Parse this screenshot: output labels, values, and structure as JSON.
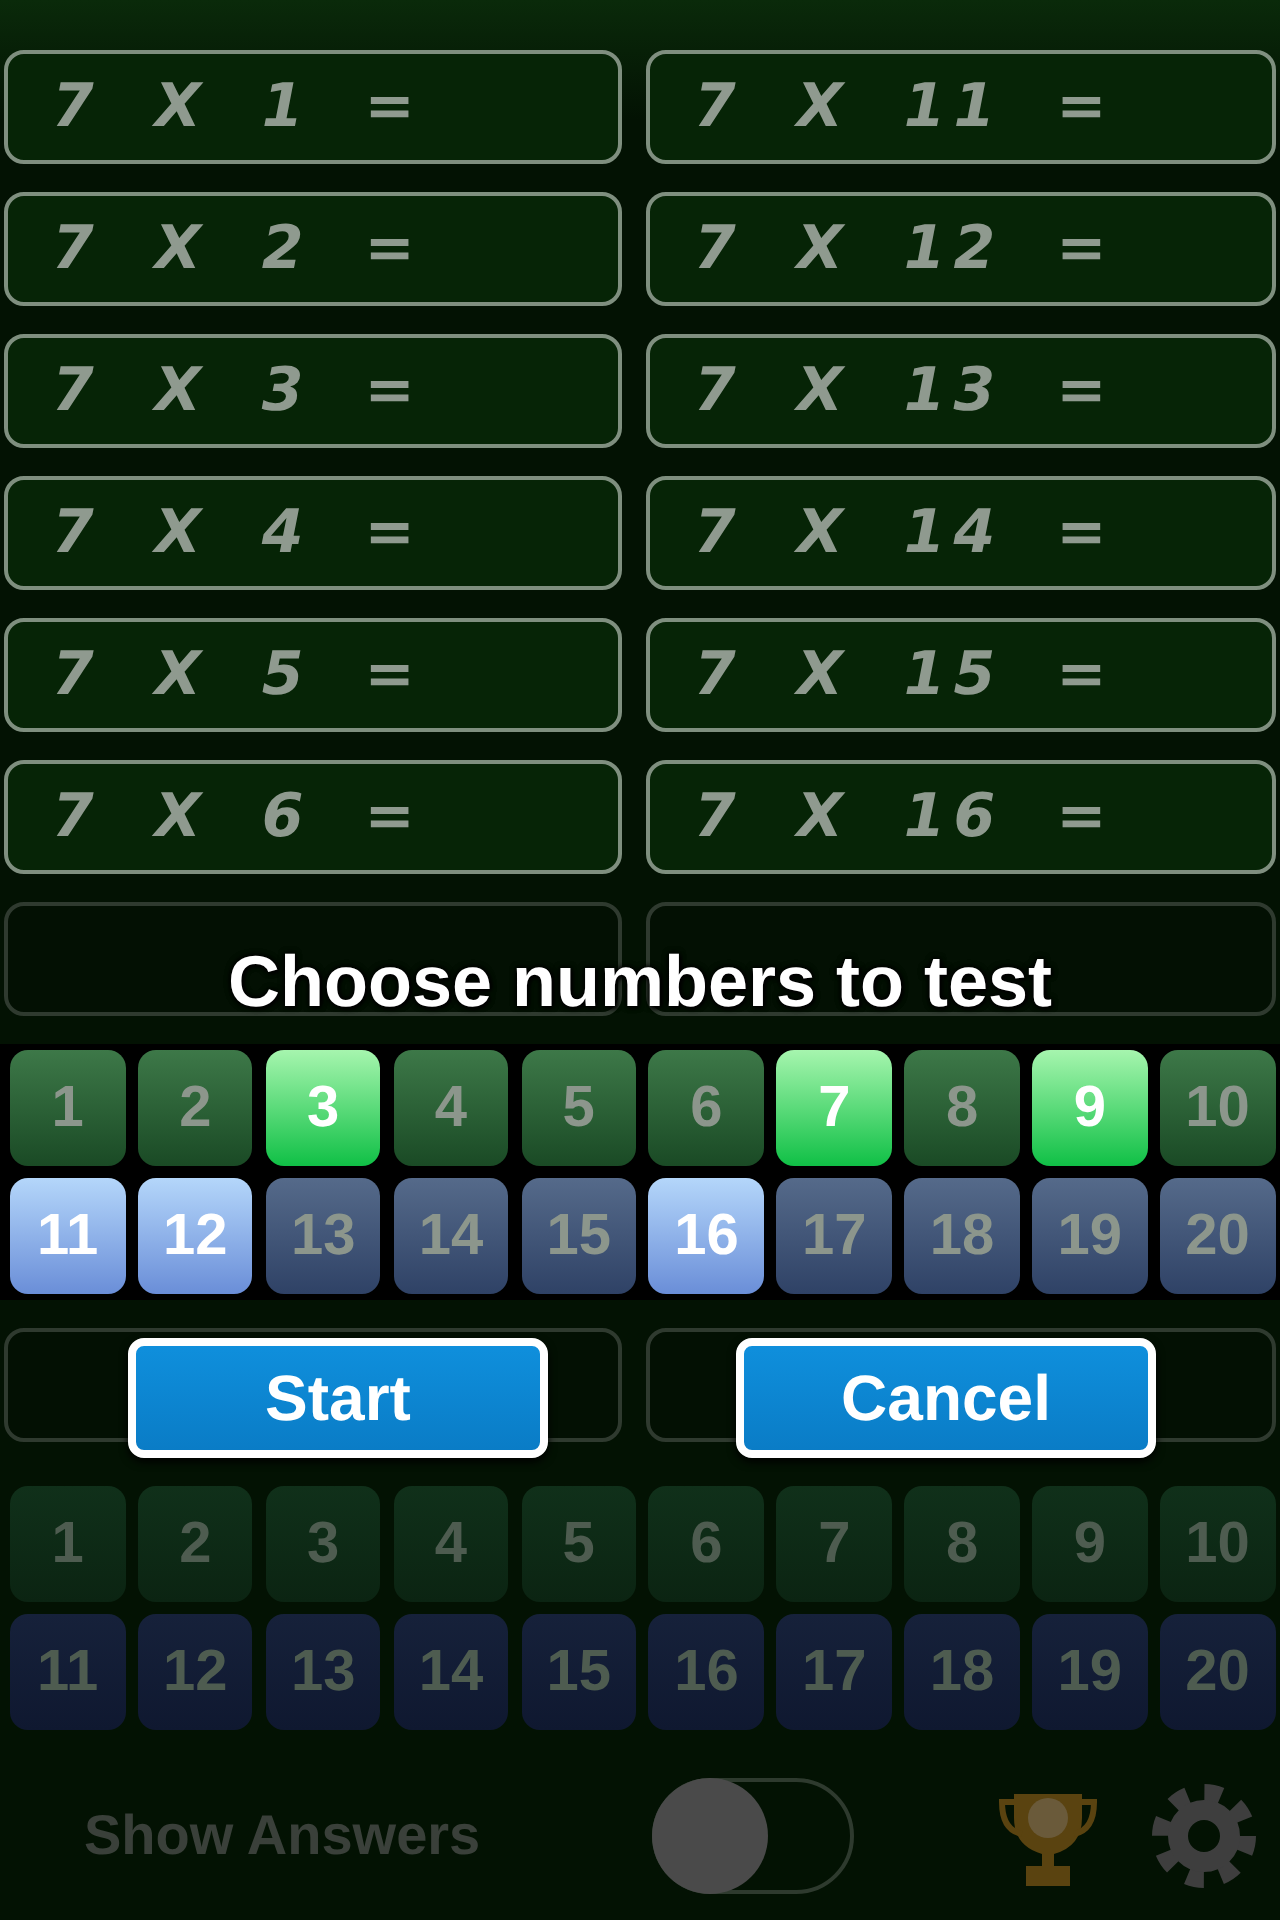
{
  "equations": {
    "left": [
      "7 X 1 =",
      "7 X 2 =",
      "7 X 3 =",
      "7 X 4 =",
      "7 X 5 =",
      "7 X 6 ="
    ],
    "right": [
      "7 X 11 =",
      "7 X 12 =",
      "7 X 13 =",
      "7 X 14 =",
      "7 X 15 =",
      "7 X 16 ="
    ]
  },
  "background_picker": {
    "rows": [
      {
        "kind": "green",
        "numbers": [
          "1",
          "2",
          "3",
          "4",
          "5",
          "6",
          "7",
          "8",
          "9",
          "10"
        ]
      },
      {
        "kind": "blue",
        "numbers": [
          "11",
          "12",
          "13",
          "14",
          "15",
          "16",
          "17",
          "18",
          "19",
          "20"
        ]
      }
    ]
  },
  "show_answers": {
    "label": "Show Answers",
    "on": false
  },
  "dialog": {
    "title": "Choose numbers to test",
    "rows": [
      {
        "kind": "green",
        "numbers": [
          {
            "label": "1",
            "selected": false
          },
          {
            "label": "2",
            "selected": false
          },
          {
            "label": "3",
            "selected": true
          },
          {
            "label": "4",
            "selected": false
          },
          {
            "label": "5",
            "selected": false
          },
          {
            "label": "6",
            "selected": false
          },
          {
            "label": "7",
            "selected": true
          },
          {
            "label": "8",
            "selected": false
          },
          {
            "label": "9",
            "selected": true
          },
          {
            "label": "10",
            "selected": false
          }
        ]
      },
      {
        "kind": "blue",
        "numbers": [
          {
            "label": "11",
            "selected": true
          },
          {
            "label": "12",
            "selected": true
          },
          {
            "label": "13",
            "selected": false
          },
          {
            "label": "14",
            "selected": false
          },
          {
            "label": "15",
            "selected": false
          },
          {
            "label": "16",
            "selected": true
          },
          {
            "label": "17",
            "selected": false
          },
          {
            "label": "18",
            "selected": false
          },
          {
            "label": "19",
            "selected": false
          },
          {
            "label": "20",
            "selected": false
          }
        ]
      }
    ],
    "buttons": [
      "Start",
      "Cancel"
    ]
  }
}
